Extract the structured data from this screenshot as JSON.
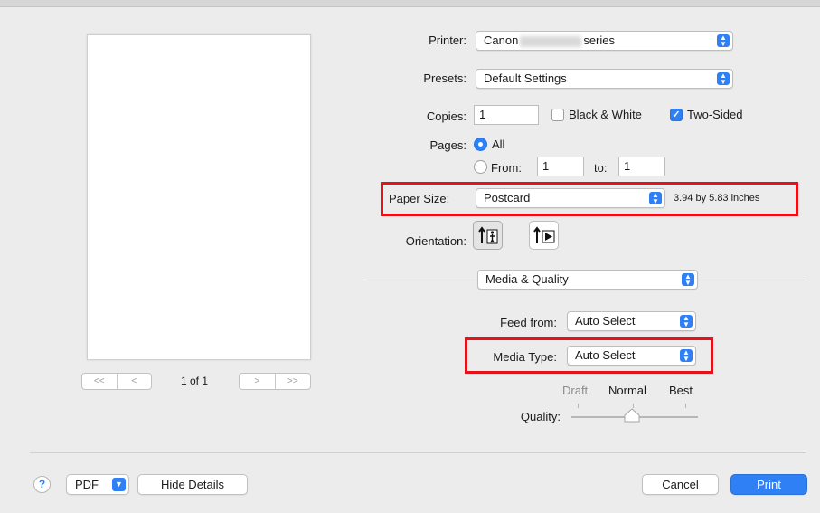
{
  "preview": {
    "nav_prev": [
      "<<",
      "<"
    ],
    "nav_next": [
      ">",
      ">>"
    ],
    "page_indicator": "1 of 1"
  },
  "printer": {
    "label": "Printer:",
    "value_prefix": "Canon",
    "value_suffix": "series"
  },
  "presets": {
    "label": "Presets:",
    "value": "Default Settings"
  },
  "copies": {
    "label": "Copies:",
    "value": "1",
    "bw_label": "Black & White",
    "bw_checked": false,
    "two_sided_label": "Two-Sided",
    "two_sided_checked": true
  },
  "pages": {
    "label": "Pages:",
    "all_label": "All",
    "from_label": "From:",
    "from_value": "1",
    "to_label": "to:",
    "to_value": "1"
  },
  "paper_size": {
    "label": "Paper Size:",
    "value": "Postcard",
    "dimensions": "3.94 by 5.83 inches"
  },
  "orientation": {
    "label": "Orientation:"
  },
  "section_popup": {
    "value": "Media & Quality"
  },
  "feed_from": {
    "label": "Feed from:",
    "value": "Auto Select"
  },
  "media_type": {
    "label": "Media Type:",
    "value": "Auto Select"
  },
  "quality": {
    "label": "Quality:",
    "options": [
      "Draft",
      "Normal",
      "Best"
    ],
    "selected": "Normal"
  },
  "footer": {
    "help": "?",
    "pdf_label": "PDF",
    "hide_details": "Hide Details",
    "cancel": "Cancel",
    "print": "Print"
  },
  "colors": {
    "accent": "#2f7ff5",
    "highlight": "#e5121a"
  }
}
